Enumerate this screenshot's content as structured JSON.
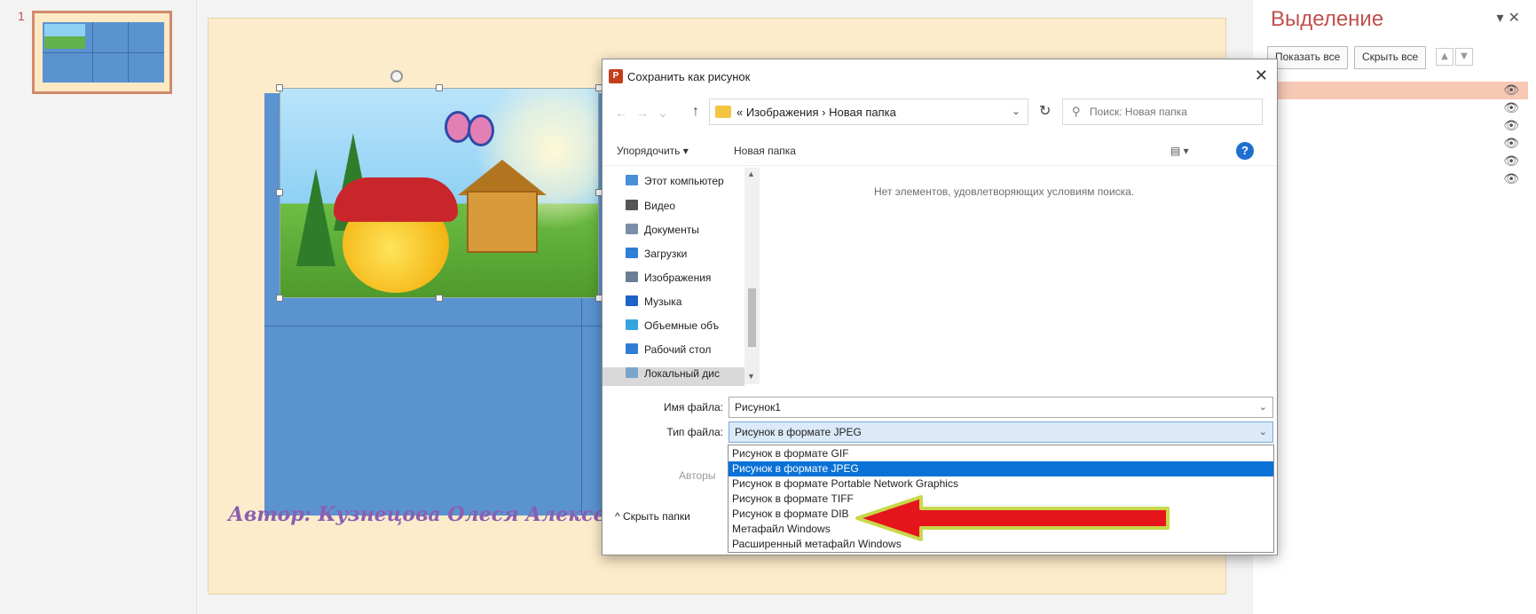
{
  "thumbnails": {
    "slide_number": "1"
  },
  "slide": {
    "author": "Автор: Кузнецова Олеся Алексеевна"
  },
  "selection_pane": {
    "title": "Выделение",
    "controls": "▾ ✕",
    "show_all": "Показать все",
    "hide_all": "Скрыть все",
    "eye_glyph": "👁"
  },
  "dialog": {
    "title": "Сохранить как рисунок",
    "close": "✕",
    "path": "« Изображения › Новая папка",
    "search_placeholder": "Поиск: Новая папка",
    "organize": "Упорядочить ▾",
    "new_folder": "Новая папка",
    "tree": [
      {
        "label": "Этот компьютер",
        "color": "#4a8fd9"
      },
      {
        "label": "Видео",
        "color": "#555555"
      },
      {
        "label": "Документы",
        "color": "#7a8ea8"
      },
      {
        "label": "Загрузки",
        "color": "#2d7fd8"
      },
      {
        "label": "Изображения",
        "color": "#6a7f95"
      },
      {
        "label": "Музыка",
        "color": "#1f63c9"
      },
      {
        "label": "Объемные объ",
        "color": "#36a4e0"
      },
      {
        "label": "Рабочий стол",
        "color": "#2f7cd6"
      },
      {
        "label": "Локальный дис",
        "color": "#7aa4c9"
      }
    ],
    "empty_message": "Нет элементов, удовлетворяющих условиям поиска.",
    "filename_label": "Имя файла:",
    "filename_value": "Рисунок1",
    "filetype_label": "Тип файла:",
    "filetype_value": "Рисунок в формате JPEG",
    "authors_label": "Авторы",
    "hide_folders": "^  Скрыть папки",
    "filetype_options": [
      "Рисунок в формате GIF",
      "Рисунок в формате JPEG",
      "Рисунок в формате Portable Network Graphics",
      "Рисунок в формате TIFF",
      "Рисунок в формате DIB",
      "Метафайл Windows",
      "Расширенный метафайл Windows"
    ],
    "highlighted_option_index": 1
  },
  "colors": {
    "accent": "#c0504d",
    "selection": "#0a72d6",
    "arrow": "#e5151b",
    "arrow_outline": "#c8d84a"
  }
}
